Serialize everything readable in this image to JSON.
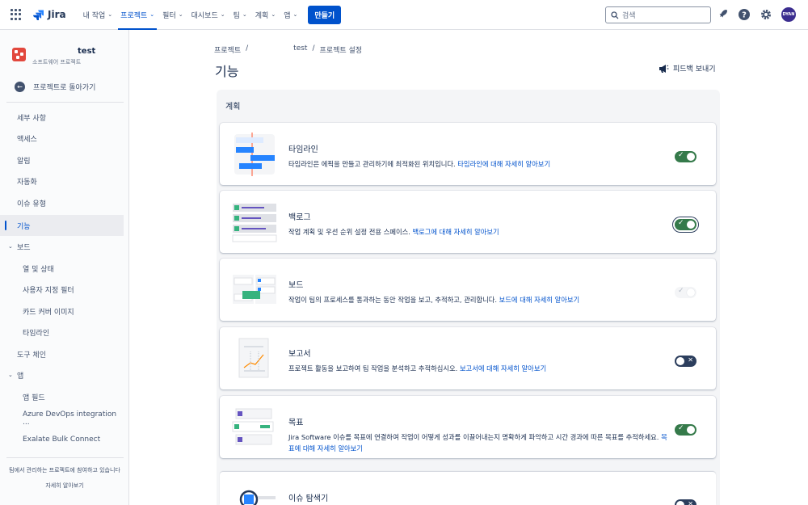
{
  "topnav": {
    "brand": "Jira",
    "items": [
      {
        "label": "내 작업"
      },
      {
        "label": "프로젝트",
        "active": true
      },
      {
        "label": "필터"
      },
      {
        "label": "대시보드"
      },
      {
        "label": "팀"
      },
      {
        "label": "계획"
      },
      {
        "label": "앱"
      }
    ],
    "create_label": "만들기",
    "search_placeholder": "검색",
    "avatar_initials": "DYAN"
  },
  "sidebar": {
    "project_name": "test",
    "project_type": "소프트웨어 프로젝트",
    "back_label": "프로젝트로 돌아가기",
    "items": [
      {
        "label": "세부 사항"
      },
      {
        "label": "액세스"
      },
      {
        "label": "알림"
      },
      {
        "label": "자동화"
      },
      {
        "label": "이슈 유형"
      },
      {
        "label": "기능",
        "active": true
      },
      {
        "label": "보드",
        "group": true
      },
      {
        "label": "열 및 상태",
        "sub": true
      },
      {
        "label": "사용자 지정 필터",
        "sub": true
      },
      {
        "label": "카드 커버 이미지",
        "sub": true
      },
      {
        "label": "타임라인",
        "sub": true
      },
      {
        "label": "도구 체인"
      },
      {
        "label": "앱",
        "group": true
      },
      {
        "label": "앱 필드",
        "sub": true
      },
      {
        "label": "Azure DevOps integration ...",
        "sub": true
      },
      {
        "label": "Exalate Bulk Connect",
        "sub": true
      }
    ],
    "footer_text": "팀에서 관리하는 프로젝트에 참여하고 있습니다",
    "footer_link": "자세히 알아보기"
  },
  "main": {
    "breadcrumbs": [
      "프로젝트",
      "/",
      "test",
      "/",
      "프로젝트 설정"
    ],
    "title": "기능",
    "feedback_label": "피드백 보내기",
    "section_title": "계획",
    "features": [
      {
        "title": "타임라인",
        "desc": "타임라인은 에픽을 만들고 관리하기에 최적화된 위치입니다.",
        "link": "타임라인에 대해 자세히 알아보기",
        "state": "on",
        "icon": "timeline-illustration"
      },
      {
        "title": "백로그",
        "desc": "작업 계획 및 우선 순위 설정 전용 스페이스.",
        "link": "백로그에 대해 자세히 알아보기",
        "state": "on-focus",
        "icon": "backlog-illustration"
      },
      {
        "title": "보드",
        "desc": "작업이 팀의 프로세스를 통과하는 동안 작업을 보고, 추적하고, 관리합니다.",
        "link": "보드에 대해 자세히 알아보기",
        "state": "disabled",
        "icon": "board-illustration"
      },
      {
        "title": "보고서",
        "desc": "프로젝트 활동을 보고하여 팀 작업을 분석하고 추적하십시오.",
        "link": "보고서에 대해 자세히 알아보기",
        "state": "off",
        "icon": "reports-illustration"
      },
      {
        "title": "목표",
        "desc": "Jira Software 이슈를 목표에 연결하여 작업이 어떻게 성과를 이끌어내는지 명확하게 파악하고 시간 경과에 따른 목표를 추적하세요.",
        "link": "목표에 대해 자세히 알아보기",
        "state": "on",
        "icon": "goals-illustration"
      },
      {
        "title": "이슈 탐색기",
        "desc": "",
        "link": "",
        "state": "off",
        "icon": "issue-navigator-illustration"
      }
    ]
  },
  "colors": {
    "accent": "#0052cc",
    "toggle_on": "#357a4a",
    "toggle_off": "#2c3e5d"
  }
}
